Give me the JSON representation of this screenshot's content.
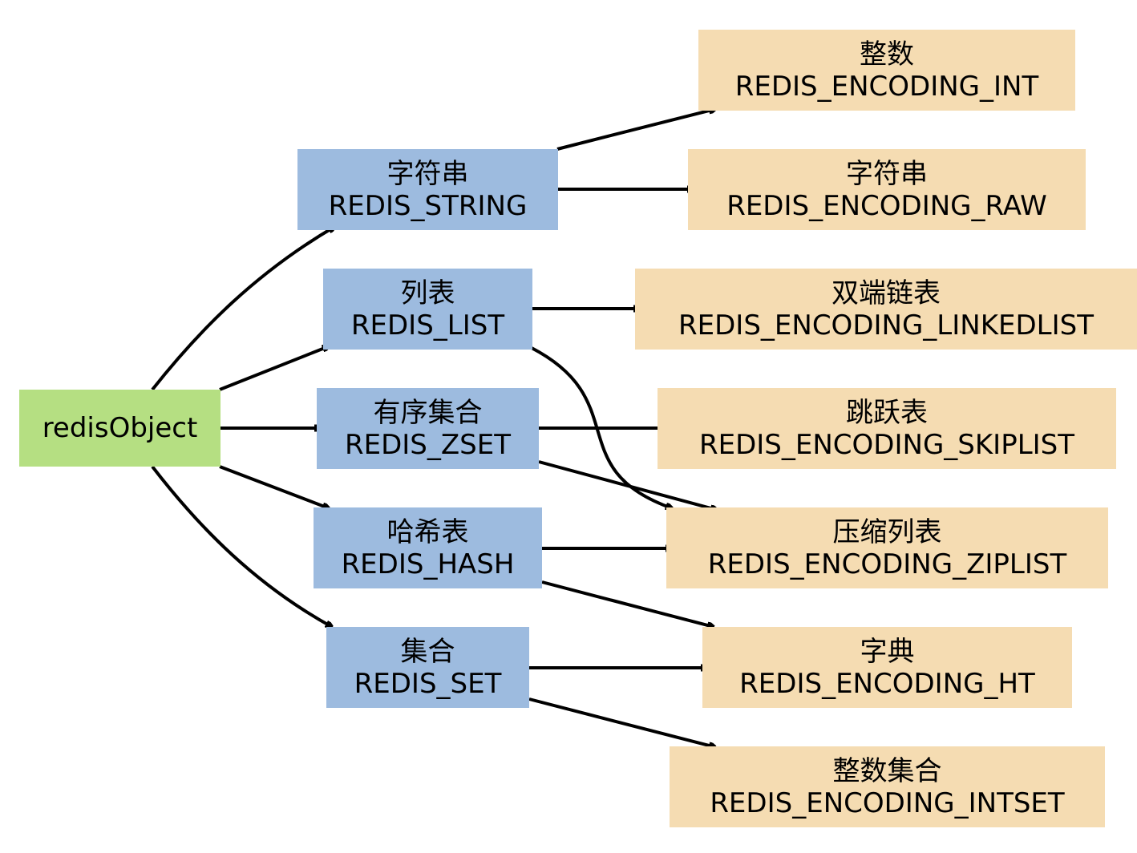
{
  "colors": {
    "root": "#b5df82",
    "type": "#9dbbdf",
    "encoding": "#f5dcb2",
    "edge": "#000000"
  },
  "root": {
    "label": "redisObject"
  },
  "types": {
    "string": {
      "zh": "字符串",
      "en": "REDIS_STRING"
    },
    "list": {
      "zh": "列表",
      "en": "REDIS_LIST"
    },
    "zset": {
      "zh": "有序集合",
      "en": "REDIS_ZSET"
    },
    "hash": {
      "zh": "哈希表",
      "en": "REDIS_HASH"
    },
    "set": {
      "zh": "集合",
      "en": "REDIS_SET"
    }
  },
  "encodings": {
    "int": {
      "zh": "整数",
      "en": "REDIS_ENCODING_INT"
    },
    "raw": {
      "zh": "字符串",
      "en": "REDIS_ENCODING_RAW"
    },
    "linkedlist": {
      "zh": "双端链表",
      "en": "REDIS_ENCODING_LINKEDLIST"
    },
    "skiplist": {
      "zh": "跳跃表",
      "en": "REDIS_ENCODING_SKIPLIST"
    },
    "ziplist": {
      "zh": "压缩列表",
      "en": "REDIS_ENCODING_ZIPLIST"
    },
    "ht": {
      "zh": "字典",
      "en": "REDIS_ENCODING_HT"
    },
    "intset": {
      "zh": "整数集合",
      "en": "REDIS_ENCODING_INTSET"
    }
  },
  "edges": [
    {
      "from": "redisObject",
      "to": "REDIS_STRING"
    },
    {
      "from": "redisObject",
      "to": "REDIS_LIST"
    },
    {
      "from": "redisObject",
      "to": "REDIS_ZSET"
    },
    {
      "from": "redisObject",
      "to": "REDIS_HASH"
    },
    {
      "from": "redisObject",
      "to": "REDIS_SET"
    },
    {
      "from": "REDIS_STRING",
      "to": "REDIS_ENCODING_INT"
    },
    {
      "from": "REDIS_STRING",
      "to": "REDIS_ENCODING_RAW"
    },
    {
      "from": "REDIS_LIST",
      "to": "REDIS_ENCODING_LINKEDLIST"
    },
    {
      "from": "REDIS_LIST",
      "to": "REDIS_ENCODING_ZIPLIST"
    },
    {
      "from": "REDIS_ZSET",
      "to": "REDIS_ENCODING_SKIPLIST"
    },
    {
      "from": "REDIS_ZSET",
      "to": "REDIS_ENCODING_ZIPLIST"
    },
    {
      "from": "REDIS_HASH",
      "to": "REDIS_ENCODING_ZIPLIST"
    },
    {
      "from": "REDIS_HASH",
      "to": "REDIS_ENCODING_HT"
    },
    {
      "from": "REDIS_SET",
      "to": "REDIS_ENCODING_HT"
    },
    {
      "from": "REDIS_SET",
      "to": "REDIS_ENCODING_INTSET"
    }
  ]
}
